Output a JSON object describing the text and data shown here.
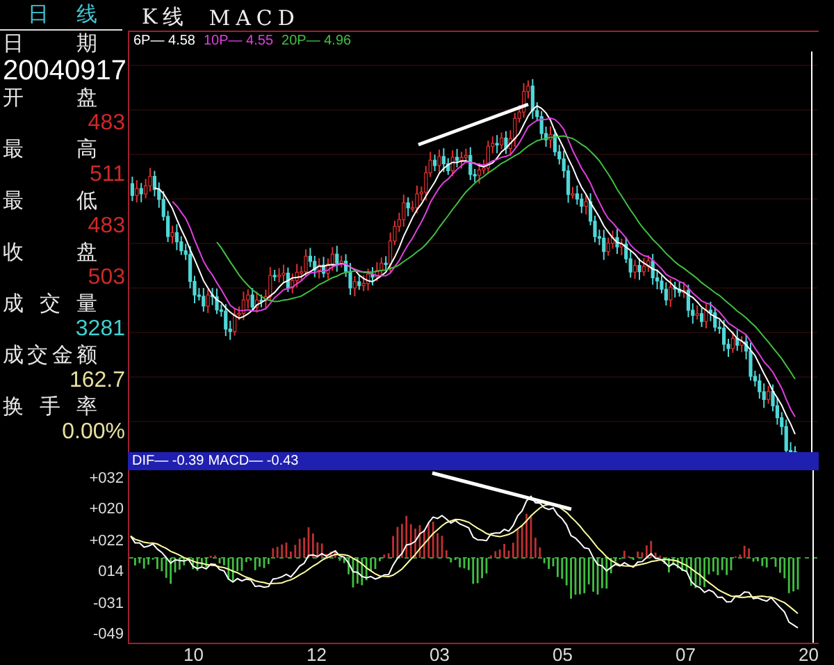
{
  "header": {
    "period_tab": "日 线",
    "chart_type": "K线",
    "indicator": "MACD"
  },
  "info_panel": [
    {
      "label": "日 期",
      "value": "20040917",
      "kind": "date"
    },
    {
      "label": "开 盘",
      "value": "483",
      "kind": "price"
    },
    {
      "label": "最 高",
      "value": "511",
      "kind": "price"
    },
    {
      "label": "最 低",
      "value": "483",
      "kind": "price"
    },
    {
      "label": "收 盘",
      "value": "503",
      "kind": "price"
    },
    {
      "label": "成 交 量",
      "value": "3281",
      "kind": "volume"
    },
    {
      "label": "成交金额",
      "value": "162.7",
      "kind": "amount"
    },
    {
      "label": "换手率",
      "value": "0.00%",
      "kind": "amount"
    }
  ],
  "price_chart": {
    "legend": [
      {
        "label": "6P—",
        "value": "4.58",
        "color": "#ffffff"
      },
      {
        "label": "10P—",
        "value": "4.55",
        "color": "#e040e0"
      },
      {
        "label": "20P—",
        "value": "4.96",
        "color": "#40c040"
      }
    ]
  },
  "macd_chart": {
    "legend": [
      {
        "label": "DIF—",
        "value": "-0.39"
      },
      {
        "label": "MACD—",
        "value": "-0.43"
      }
    ],
    "y_labels": [
      "+032",
      "+020",
      "+022",
      "014",
      "-031",
      "-049"
    ],
    "x_labels": [
      "10",
      "12",
      "03",
      "05",
      "07",
      "20"
    ]
  }
}
